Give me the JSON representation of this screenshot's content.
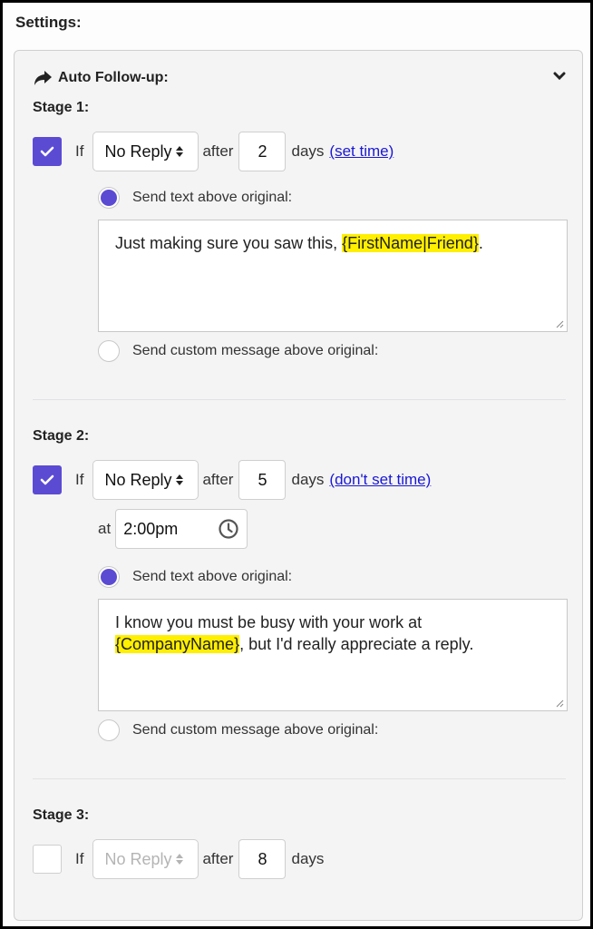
{
  "settings_title": "Settings:",
  "panel": {
    "icon": "share-arrow-icon",
    "title": "Auto Follow-up:",
    "collapse_icon": "chevron-down-icon"
  },
  "colors": {
    "accent": "#5b4bd3",
    "highlight": "#ffef00",
    "link": "#1a18d4"
  },
  "stages": [
    {
      "title": "Stage 1:",
      "enabled": true,
      "if_label": "If",
      "condition": "No Reply",
      "after_label": "after",
      "days": "2",
      "days_label": "days",
      "time_link": "(set time)",
      "option_text_label": "Send text above original:",
      "option_custom_label": "Send custom message above original:",
      "selected_option": "text",
      "message_parts": [
        {
          "text": "Just making sure you saw this, ",
          "highlight": false
        },
        {
          "text": "{FirstName|Friend}",
          "highlight": true
        },
        {
          "text": ".",
          "highlight": false
        }
      ]
    },
    {
      "title": "Stage 2:",
      "enabled": true,
      "if_label": "If",
      "condition": "No Reply",
      "after_label": "after",
      "days": "5",
      "days_label": "days",
      "time_link": "(don't set time)",
      "at_label": "at",
      "time": "2:00pm",
      "option_text_label": "Send text above original:",
      "option_custom_label": "Send custom message above original:",
      "selected_option": "text",
      "message_parts": [
        {
          "text": "I know you must be busy with your work at ",
          "highlight": false
        },
        {
          "text": "{CompanyName}",
          "highlight": true
        },
        {
          "text": ", but I'd really appreciate a reply.",
          "highlight": false
        }
      ]
    },
    {
      "title": "Stage 3:",
      "enabled": false,
      "if_label": "If",
      "condition": "No Reply",
      "after_label": "after",
      "days": "8",
      "days_label": "days"
    }
  ]
}
